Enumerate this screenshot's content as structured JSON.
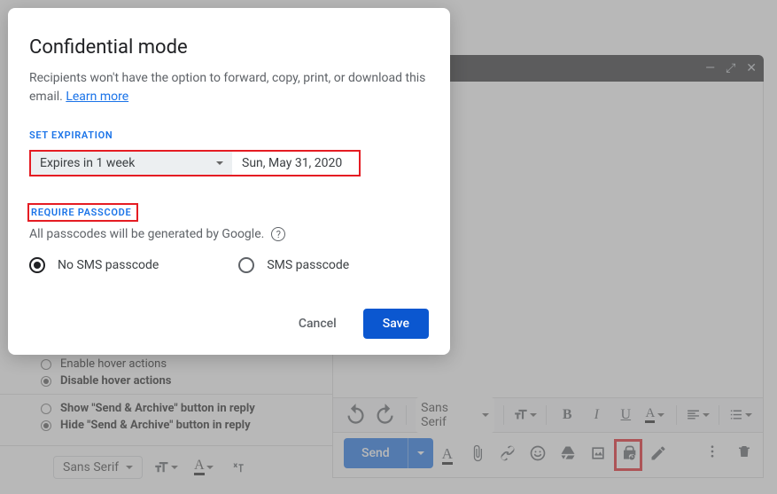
{
  "modal": {
    "title": "Confidential mode",
    "desc": "Recipients won't have the option to forward, copy, print, or download this email.",
    "learn_more": "Learn more",
    "set_expiration": "SET EXPIRATION",
    "expires_label": "Expires in 1 week",
    "expires_date": "Sun, May 31, 2020",
    "require_passcode": "REQUIRE PASSCODE",
    "passcode_hint": "All passcodes will be generated by Google.",
    "radio_no_sms": "No SMS passcode",
    "radio_sms": "SMS passcode",
    "cancel": "Cancel",
    "save": "Save"
  },
  "settings": {
    "hover": {
      "enable": "Enable hover actions",
      "disable": "Disable hover actions"
    },
    "send_archive": {
      "show": "Show \"Send & Archive\" button in reply",
      "hide": "Hide \"Send & Archive\" button in reply"
    },
    "font_label": "Sans Serif"
  },
  "compose": {
    "font_label": "Sans Serif",
    "format": {
      "bold": "B",
      "italic": "I",
      "underline": "U",
      "color": "A"
    },
    "send": "Send",
    "text_color": "A"
  }
}
